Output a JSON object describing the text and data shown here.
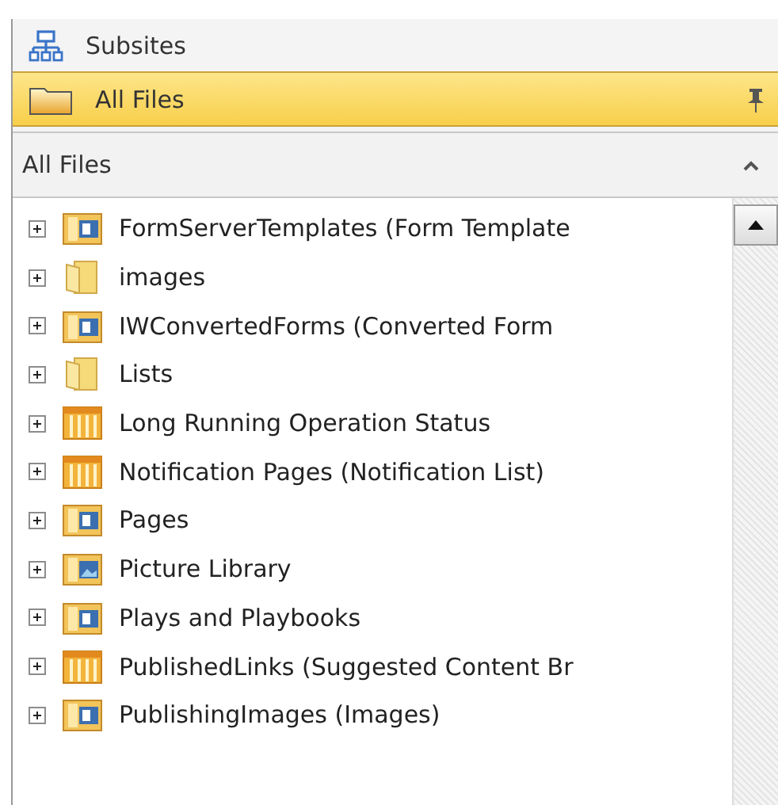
{
  "nav": [
    {
      "label": "Subsites",
      "kind": "subsites",
      "selected": false
    },
    {
      "label": "All Files",
      "kind": "folder",
      "selected": true
    }
  ],
  "section": {
    "title": "All Files",
    "expanded": true
  },
  "tree": [
    {
      "label": "FormServerTemplates (Form Template",
      "kind": "library",
      "expanded": false
    },
    {
      "label": "images",
      "kind": "folder",
      "expanded": false
    },
    {
      "label": "IWConvertedForms (Converted Form",
      "kind": "library",
      "expanded": false
    },
    {
      "label": "Lists",
      "kind": "folder",
      "expanded": false
    },
    {
      "label": "Long Running Operation Status",
      "kind": "list",
      "expanded": false
    },
    {
      "label": "Notification Pages (Notification List)",
      "kind": "list",
      "expanded": false
    },
    {
      "label": "Pages",
      "kind": "library",
      "expanded": false
    },
    {
      "label": "Picture Library",
      "kind": "pictures",
      "expanded": false
    },
    {
      "label": "Plays and Playbooks",
      "kind": "library",
      "expanded": false
    },
    {
      "label": "PublishedLinks (Suggested Content Br",
      "kind": "list",
      "expanded": false
    },
    {
      "label": "PublishingImages (Images)",
      "kind": "library",
      "expanded": false
    }
  ]
}
